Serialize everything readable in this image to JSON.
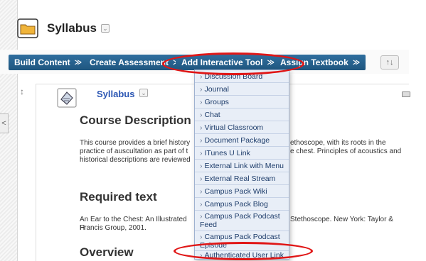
{
  "page": {
    "title": "Syllabus"
  },
  "toolbar": {
    "buttons": [
      {
        "label": "Build Content"
      },
      {
        "label": "Create Assessment"
      },
      {
        "label": "Add Interactive Tool"
      },
      {
        "label": "Assign Textbook"
      }
    ],
    "chevron": "≫",
    "sort_label": "↑↓"
  },
  "content": {
    "item_title": "Syllabus",
    "sections": [
      {
        "heading": "Course Description",
        "text": "This course provides a brief history",
        "text_right": "ethoscope, with its roots in the",
        "text2_left": "practice of auscultation as part of t",
        "text2_right": "e chest. Principles of acoustics and",
        "text3_left": "historical descriptions are reviewed"
      },
      {
        "heading": "Required text",
        "text": "An Ear to the Chest: An Illustrated H",
        "text_right": "Stethoscope. New York: Taylor &",
        "text2_left": "Francis Group, 2001."
      },
      {
        "heading": "Overview"
      }
    ]
  },
  "dropdown": {
    "items": [
      "Discussion Board",
      "Journal",
      "Groups",
      "Chat",
      "Virtual Classroom",
      "Document Package",
      "ITunes U Link",
      "External Link with Menu",
      "External Real Stream",
      "Campus Pack Wiki",
      "Campus Pack Blog",
      "Campus Pack Podcast Feed",
      "Campus Pack Podcast Episode",
      "Authenticated User Link"
    ]
  },
  "colors": {
    "accent": "#1f567f",
    "highlight_ring": "#e01616"
  }
}
